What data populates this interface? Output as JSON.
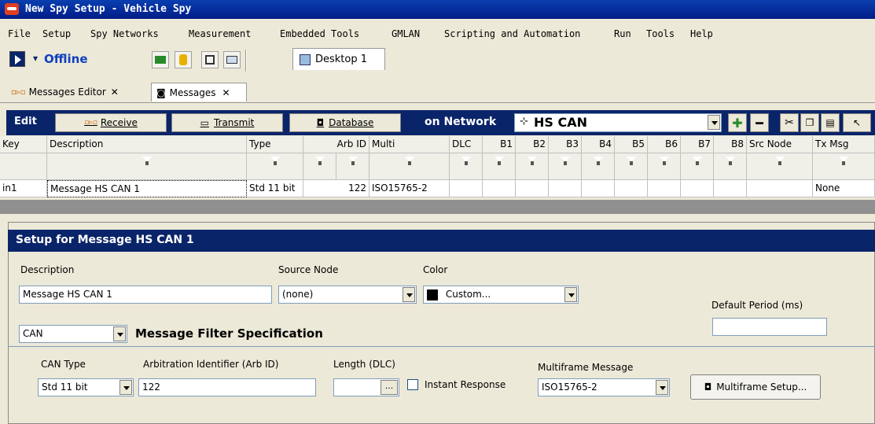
{
  "window": {
    "title": "New Spy Setup - Vehicle Spy"
  },
  "menu": [
    "File",
    "Setup",
    "Spy Networks",
    "Measurement",
    "Embedded Tools",
    "GMLAN",
    "Scripting and Automation",
    "Run",
    "Tools",
    "Help"
  ],
  "toolbar": {
    "status": "Offline",
    "desktop_tab": "Desktop 1"
  },
  "doc_tabs": [
    "Messages Editor",
    "Messages"
  ],
  "editbar": {
    "edit_label": "Edit",
    "receive": "Receive",
    "transmit": "Transmit",
    "database": "Database",
    "network_label": "on Network",
    "network_value": "HS CAN"
  },
  "grid": {
    "headers": [
      "Key",
      "Description",
      "Type",
      "Arb ID",
      "Multi",
      "DLC",
      "B1",
      "B2",
      "B3",
      "B4",
      "B5",
      "B6",
      "B7",
      "B8",
      "Src Node",
      "Tx Msg"
    ],
    "row": [
      "in1",
      "Message HS CAN 1",
      "Std 11 bit",
      "122",
      "ISO15765-2",
      "",
      "",
      "",
      "",
      "",
      "",
      "",
      "",
      "",
      "",
      "None"
    ]
  },
  "setup": {
    "title": "Setup for Message HS CAN 1",
    "description_label": "Description",
    "description_value": "Message HS CAN 1",
    "source_node_label": "Source Node",
    "source_node_value": "(none)",
    "color_label": "Color",
    "color_value": "Custom...",
    "default_period_label": "Default Period (ms)",
    "default_period_value": "",
    "filter_type_value": "CAN",
    "filter_spec_label": "Message Filter Specification",
    "can_type_label": "CAN Type",
    "can_type_value": "Std 11 bit",
    "arb_id_label": "Arbitration Identifier (Arb ID)",
    "arb_id_value": "122",
    "length_label": "Length (DLC)",
    "length_value": "",
    "length_button": "...",
    "instant_response_label": "Instant Response",
    "multiframe_label": "Multiframe Message",
    "multiframe_value": "ISO15765-2",
    "multiframe_setup_button": "Multiframe Setup..."
  }
}
